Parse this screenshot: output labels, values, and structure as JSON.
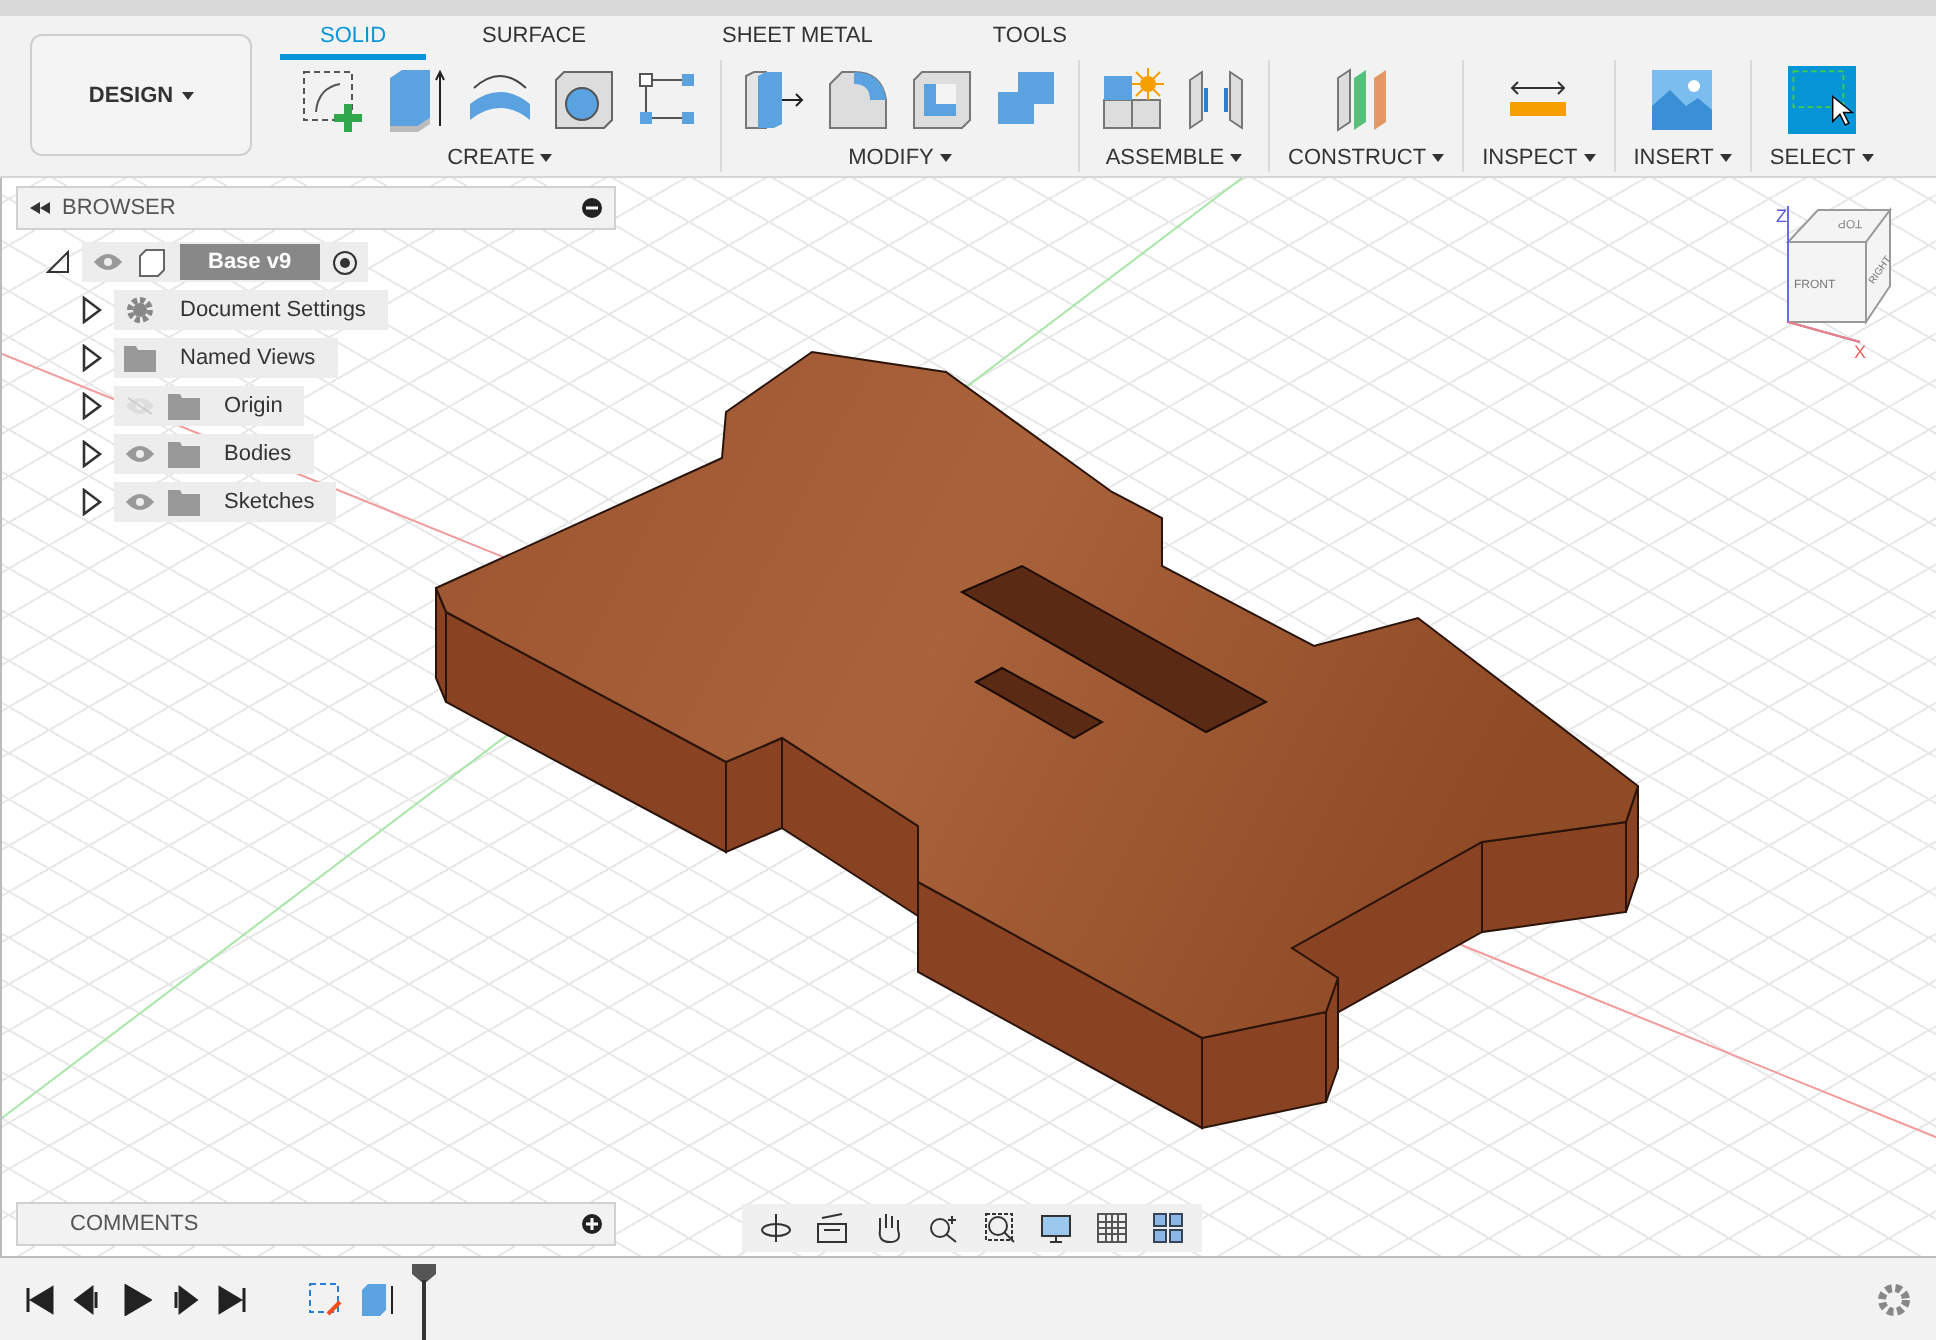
{
  "workspace": {
    "label": "DESIGN"
  },
  "tabs": [
    {
      "label": "SOLID",
      "selected": true
    },
    {
      "label": "SURFACE",
      "selected": false
    },
    {
      "label": "SHEET METAL",
      "selected": false
    },
    {
      "label": "TOOLS",
      "selected": false
    }
  ],
  "groups": [
    {
      "label": "CREATE",
      "tools": [
        {
          "kind": "sketch"
        },
        {
          "kind": "extrude"
        },
        {
          "kind": "revolve"
        },
        {
          "kind": "hole"
        },
        {
          "kind": "pattern"
        }
      ]
    },
    {
      "label": "MODIFY",
      "tools": [
        {
          "kind": "presspull"
        },
        {
          "kind": "fillet"
        },
        {
          "kind": "shell"
        },
        {
          "kind": "combine"
        }
      ]
    },
    {
      "label": "ASSEMBLE",
      "tools": [
        {
          "kind": "component"
        },
        {
          "kind": "joint"
        }
      ]
    },
    {
      "label": "CONSTRUCT",
      "tools": [
        {
          "kind": "plane"
        }
      ]
    },
    {
      "label": "INSPECT",
      "tools": [
        {
          "kind": "measure"
        }
      ]
    },
    {
      "label": "INSERT",
      "tools": [
        {
          "kind": "image"
        }
      ]
    },
    {
      "label": "SELECT",
      "tools": [
        {
          "kind": "select"
        }
      ]
    }
  ],
  "browser": {
    "title": "BROWSER",
    "root": {
      "label": "Base v9",
      "visible": true,
      "expanded": true,
      "children": [
        {
          "label": "Document Settings",
          "kind": "gear",
          "expanded": false
        },
        {
          "label": "Named Views",
          "kind": "folder",
          "expanded": false
        },
        {
          "label": "Origin",
          "kind": "folder",
          "visible": false,
          "expanded": false
        },
        {
          "label": "Bodies",
          "kind": "folder",
          "visible": true,
          "expanded": false
        },
        {
          "label": "Sketches",
          "kind": "folder",
          "visible": true,
          "expanded": false
        }
      ]
    }
  },
  "viewcube": {
    "top": "TOP",
    "front": "FRONT",
    "right": "RIGHT",
    "z_axis": "Z",
    "x_axis": "X"
  },
  "comments": {
    "title": "COMMENTS"
  },
  "navbar": [
    {
      "kind": "orbit"
    },
    {
      "kind": "look"
    },
    {
      "kind": "pan"
    },
    {
      "kind": "zoom"
    },
    {
      "kind": "fit"
    },
    {
      "kind": "display"
    },
    {
      "kind": "grid"
    },
    {
      "kind": "viewports"
    }
  ],
  "timeline": {
    "controls": [
      {
        "kind": "first"
      },
      {
        "kind": "previous"
      },
      {
        "kind": "play"
      },
      {
        "kind": "next"
      },
      {
        "kind": "last"
      }
    ],
    "features": [
      {
        "kind": "sketch"
      },
      {
        "kind": "extrude"
      }
    ]
  }
}
